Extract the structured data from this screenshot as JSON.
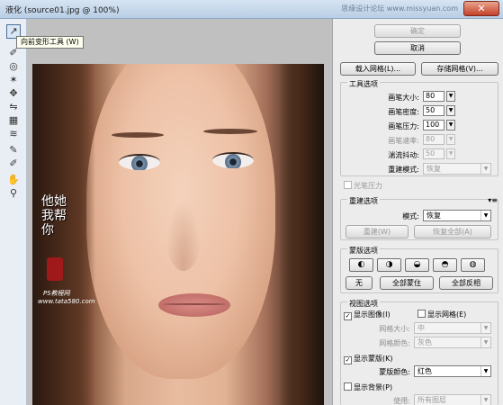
{
  "window": {
    "title": "液化 (source01.jpg @ 100%)",
    "watermark": "思缘设计论坛  www.missyuan.com",
    "close_glyph": "✕"
  },
  "toolbar": {
    "tools": [
      {
        "name": "forward-warp-tool",
        "glyph": "↗"
      },
      {
        "name": "reconstruct-tool",
        "glyph": "✐"
      },
      {
        "name": "twirl-tool",
        "glyph": "◎"
      },
      {
        "name": "pucker-tool",
        "glyph": "✶"
      },
      {
        "name": "bloat-tool",
        "glyph": "✥"
      },
      {
        "name": "push-left-tool",
        "glyph": "⇋"
      },
      {
        "name": "mirror-tool",
        "glyph": "▦"
      },
      {
        "name": "turbulence-tool",
        "glyph": "≋"
      },
      {
        "name": "freeze-mask-tool",
        "glyph": "✎"
      },
      {
        "name": "thaw-mask-tool",
        "glyph": "✐"
      },
      {
        "name": "hand-tool",
        "glyph": "✋"
      },
      {
        "name": "zoom-tool",
        "glyph": "⚲"
      }
    ],
    "tooltip": "向前变形工具 (W)"
  },
  "canvas": {
    "calligraphy": "他她我帮你",
    "watermark_line1": "PS教程网",
    "watermark_line2": "www.tata580.com"
  },
  "panel": {
    "ok_label": "确定",
    "cancel_label": "取消",
    "load_mesh_label": "载入网格(L)...",
    "save_mesh_label": "存储网格(V)...",
    "tool_options": {
      "title": "工具选项",
      "brush_size_label": "画笔大小:",
      "brush_size": "80",
      "brush_density_label": "画笔密度:",
      "brush_density": "50",
      "brush_pressure_label": "画笔压力:",
      "brush_pressure": "100",
      "brush_rate_label": "画笔速率:",
      "brush_rate": "80",
      "turbulent_jitter_label": "湍流抖动:",
      "turbulent_jitter": "50",
      "reconstruct_mode_label": "重建模式:",
      "reconstruct_mode": "恢复",
      "stylus_pressure_label": "光笔压力"
    },
    "reconstruct_options": {
      "title": "重建选项",
      "mode_label": "模式:",
      "mode": "恢复",
      "reconstruct_label": "重建(W)",
      "restore_all_label": "恢复全部(A)"
    },
    "mask_options": {
      "title": "蒙版选项",
      "none_label": "无",
      "mask_all_label": "全部蒙住",
      "invert_all_label": "全部反相",
      "mask_glyphs": [
        "◐",
        "◑",
        "◒",
        "◓",
        "◍"
      ]
    },
    "view_options": {
      "title": "视图选项",
      "show_image_label": "显示图像(I)",
      "show_mesh_label": "显示网格(E)",
      "mesh_size_label": "网格大小:",
      "mesh_size": "中",
      "mesh_color_label": "网格颜色:",
      "mesh_color": "灰色",
      "show_mask_label": "显示蒙版(K)",
      "mask_color_label": "蒙版颜色:",
      "mask_color": "红色",
      "show_backdrop_label": "显示背景(P)",
      "use_label": "使用:",
      "use_value": "所有图层"
    },
    "menu_glyph": "▾≡",
    "check_glyph": "✓",
    "dropdown_glyph": "▼"
  }
}
